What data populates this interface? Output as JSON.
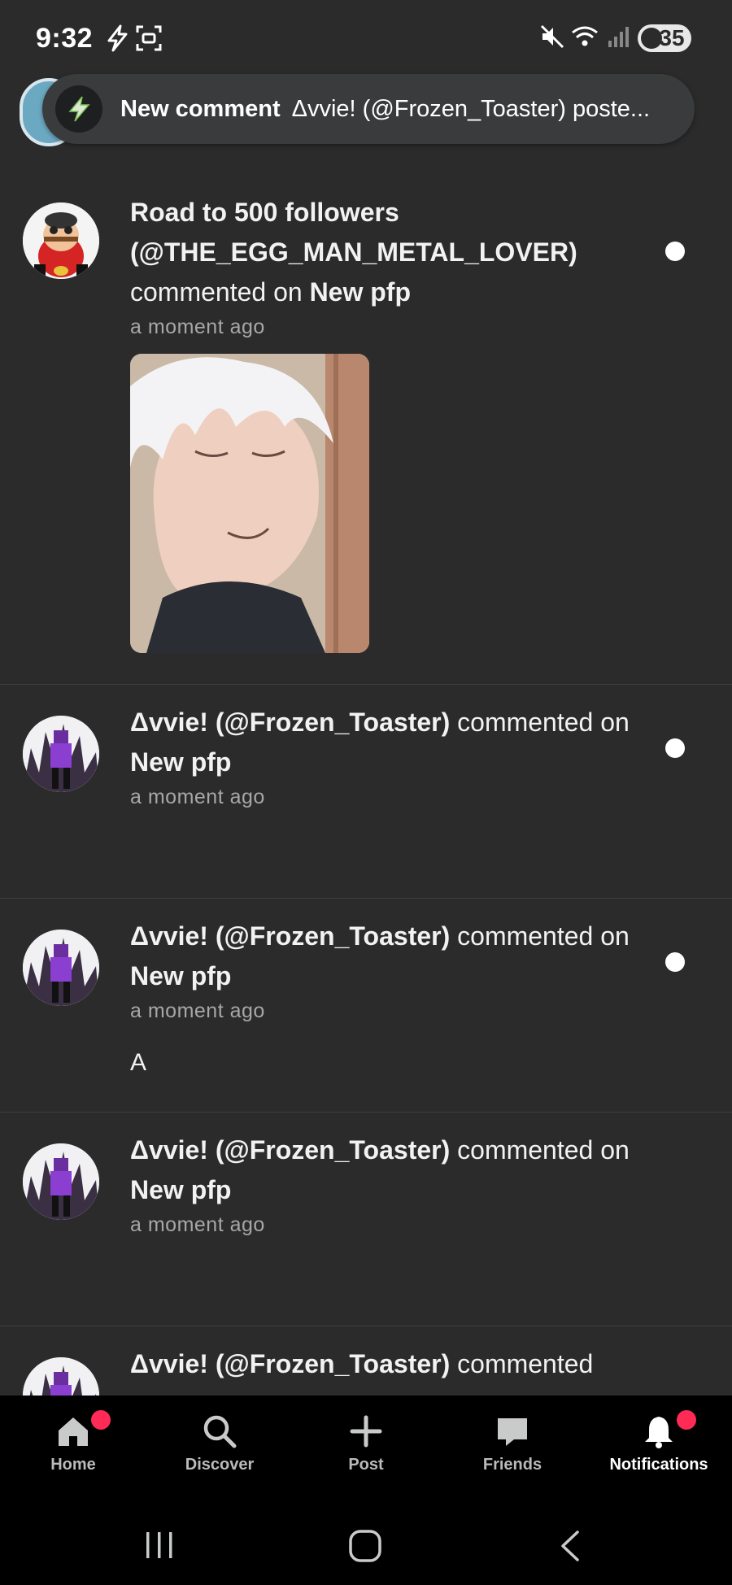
{
  "status_bar": {
    "time": "9:32",
    "battery": "35"
  },
  "toast": {
    "title": "New comment",
    "text": "Δvvie! (@Frozen_Toaster) poste..."
  },
  "notifications": [
    {
      "actor": "Road to 500 followers (@THE_EGG_MAN_METAL_LOVER)",
      "verb": "commented on",
      "target": "New pfp",
      "time": "a moment ago",
      "unread": true,
      "has_image": true
    },
    {
      "actor": "Δvvie! (@Frozen_Toaster)",
      "verb": "commented on",
      "target": "New pfp",
      "time": "a moment ago",
      "unread": true
    },
    {
      "actor": "Δvvie! (@Frozen_Toaster)",
      "verb": "commented on",
      "target": "New pfp",
      "time": "a moment ago",
      "unread": true,
      "comment": "A"
    },
    {
      "actor": "Δvvie! (@Frozen_Toaster)",
      "verb": "commented on",
      "target": "New pfp",
      "time": "a moment ago",
      "unread": false
    },
    {
      "actor": "Δvvie! (@Frozen_Toaster)",
      "verb": "commented"
    }
  ],
  "nav": [
    {
      "label": "Home",
      "icon": "home-icon",
      "badge": true
    },
    {
      "label": "Discover",
      "icon": "search-icon",
      "badge": false
    },
    {
      "label": "Post",
      "icon": "plus-icon",
      "badge": false
    },
    {
      "label": "Friends",
      "icon": "chat-icon",
      "badge": false
    },
    {
      "label": "Notifications",
      "icon": "bell-icon",
      "badge": true,
      "active": true
    }
  ],
  "colors": {
    "background": "#2a2b2a",
    "badge": "#ff2a55",
    "nav_background": "#000000"
  }
}
